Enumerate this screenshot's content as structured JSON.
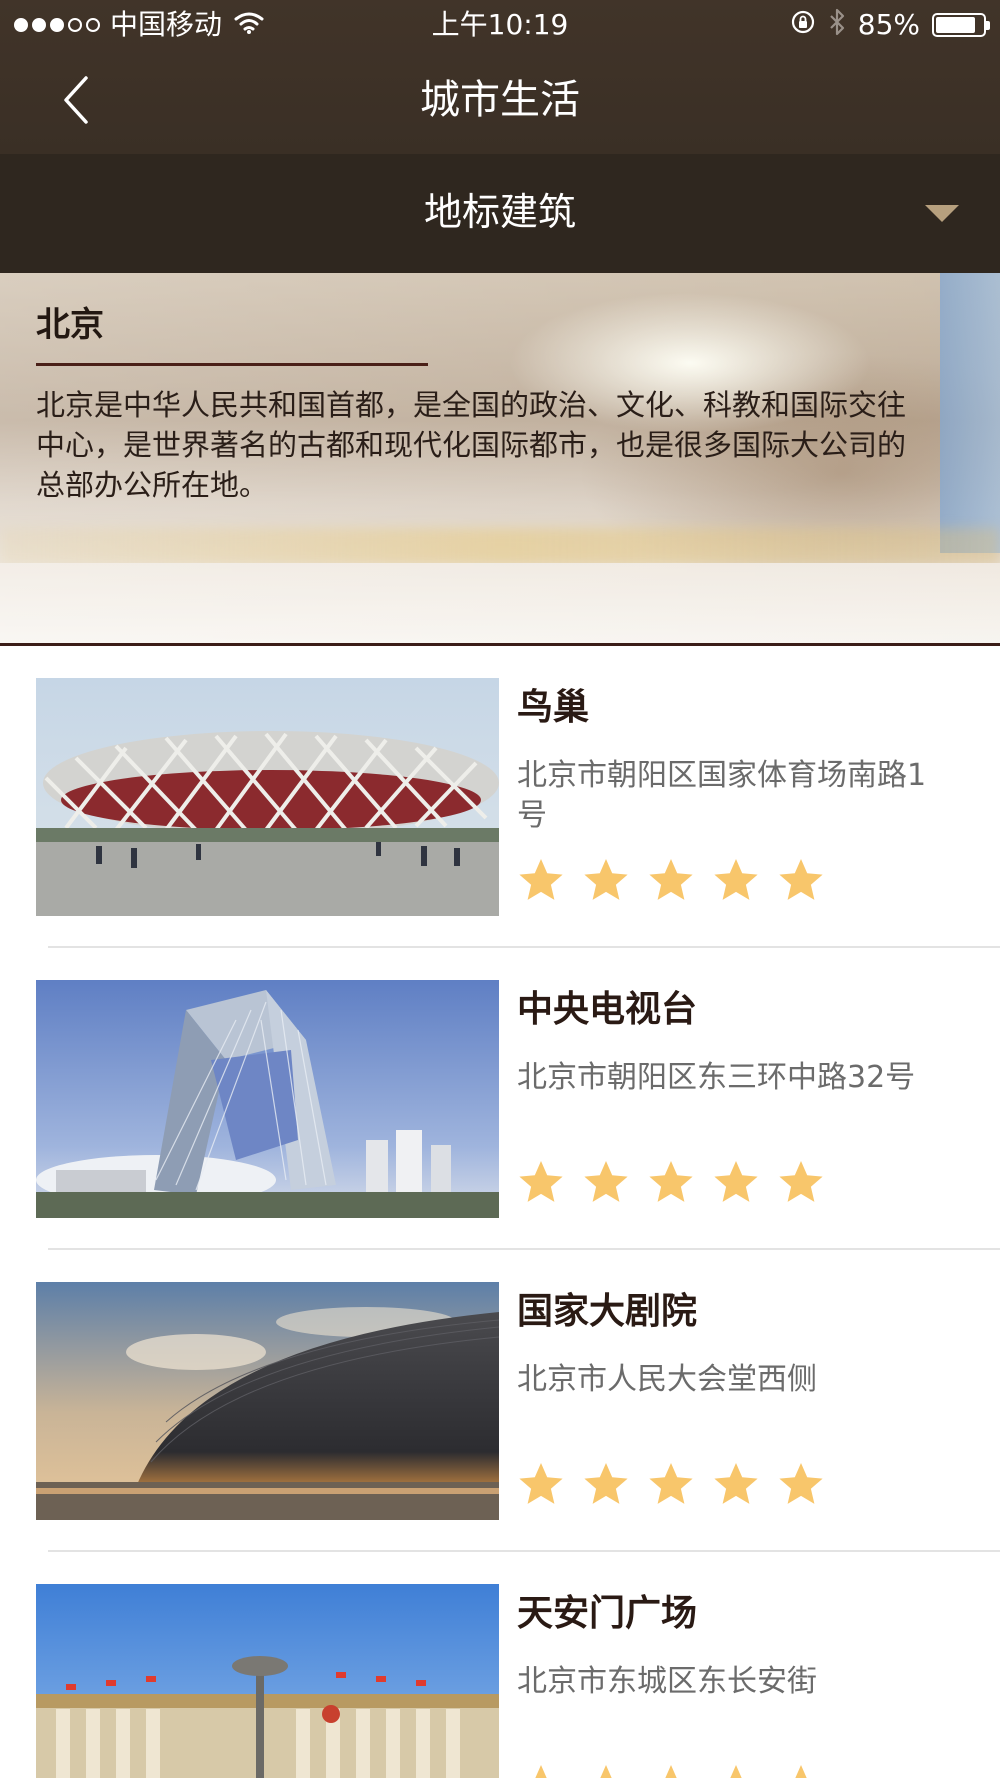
{
  "status_bar": {
    "carrier": "中国移动",
    "time": "上午10:19",
    "battery": "85%",
    "battery_level": 0.85,
    "signal_bars": 3,
    "signal_total": 5
  },
  "nav": {
    "title": "城市生活"
  },
  "category": {
    "selected": "地标建筑"
  },
  "city": {
    "name": "北京",
    "description": "北京是中华人民共和国首都，是全国的政治、文化、科教和国际交往中心，是世界著名的古都和现代化国际都市，也是很多国际大公司的总部办公所在地。"
  },
  "landmarks": [
    {
      "name": "鸟巢",
      "address": "北京市朝阳区国家体育场南路1号",
      "rating": 5,
      "photo": "birds-nest-stadium"
    },
    {
      "name": "中央电视台",
      "address": "北京市朝阳区东三环中路32号",
      "rating": 5,
      "photo": "cctv-headquarters"
    },
    {
      "name": "国家大剧院",
      "address": "北京市人民大会堂西侧",
      "rating": 5,
      "photo": "national-grand-theater"
    },
    {
      "name": "天安门广场",
      "address": "北京市东城区东长安街",
      "rating": 5,
      "photo": "great-hall-of-the-people"
    }
  ],
  "colors": {
    "header_bg": "#3d3128",
    "category_bg": "#2f271f",
    "accent_arrow": "#b7a07e",
    "star": "#f8c66b",
    "title_text": "#2a1a14",
    "address_text": "#6b6b6b"
  }
}
